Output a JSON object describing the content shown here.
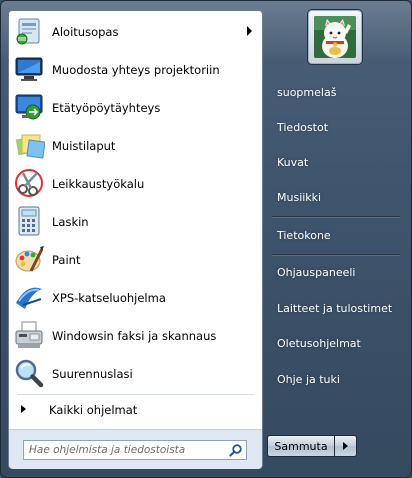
{
  "programs": [
    {
      "label": "Aloitusopas",
      "icon": "getting-started-icon",
      "has_submenu": true
    },
    {
      "label": "Muodosta yhteys projektoriin",
      "icon": "projector-icon",
      "has_submenu": false
    },
    {
      "label": "Etätyöpöytäyhteys",
      "icon": "remote-desktop-icon",
      "has_submenu": false
    },
    {
      "label": "Muistilaput",
      "icon": "sticky-notes-icon",
      "has_submenu": false
    },
    {
      "label": "Leikkaustyökalu",
      "icon": "snipping-tool-icon",
      "has_submenu": false
    },
    {
      "label": "Laskin",
      "icon": "calculator-icon",
      "has_submenu": false
    },
    {
      "label": "Paint",
      "icon": "paint-icon",
      "has_submenu": false
    },
    {
      "label": "XPS-katseluohjelma",
      "icon": "xps-viewer-icon",
      "has_submenu": false
    },
    {
      "label": "Windowsin faksi ja skannaus",
      "icon": "fax-scan-icon",
      "has_submenu": false
    },
    {
      "label": "Suurennuslasi",
      "icon": "magnifier-icon",
      "has_submenu": false
    }
  ],
  "all_programs": {
    "label": "Kaikki ohjelmat"
  },
  "search": {
    "placeholder": "Hae ohjelmista ja tiedostoista",
    "value": ""
  },
  "user": {
    "picture": "lucky-cat-avatar"
  },
  "places": [
    {
      "label": "suopmelaš"
    },
    {
      "label": "Tiedostot"
    },
    {
      "label": "Kuvat"
    },
    {
      "label": "Musiikki"
    },
    {
      "label": "Tietokone"
    },
    {
      "label": "Ohjauspaneeli"
    },
    {
      "label": "Laitteet ja tulostimet"
    },
    {
      "label": "Oletusohjelmat"
    },
    {
      "label": "Ohje ja tuki"
    }
  ],
  "shutdown": {
    "label": "Sammuta"
  }
}
